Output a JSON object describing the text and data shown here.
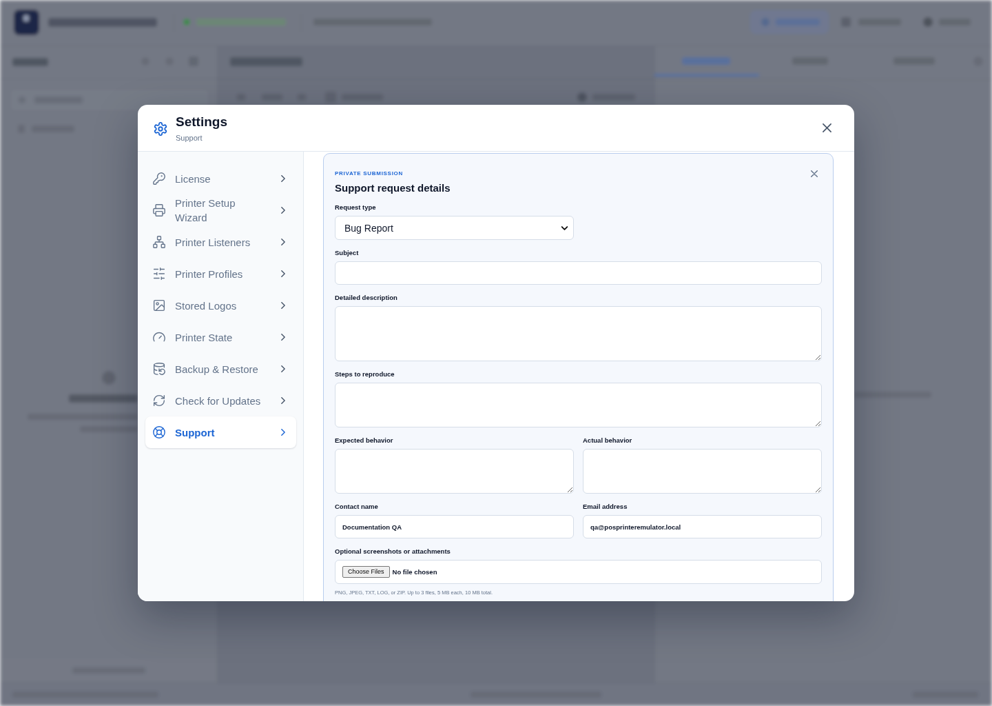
{
  "settings_dialog": {
    "title": "Settings",
    "subtitle": "Support",
    "nav": [
      {
        "label": "License",
        "selected": false
      },
      {
        "label": "Printer Setup Wizard",
        "selected": false
      },
      {
        "label": "Printer Listeners",
        "selected": false
      },
      {
        "label": "Printer Profiles",
        "selected": false
      },
      {
        "label": "Stored Logos",
        "selected": false
      },
      {
        "label": "Printer State",
        "selected": false
      },
      {
        "label": "Backup & Restore",
        "selected": false
      },
      {
        "label": "Check for Updates",
        "selected": false
      },
      {
        "label": "Support",
        "selected": true
      }
    ],
    "support_request": {
      "eyebrow": "PRIVATE SUBMISSION",
      "title": "Support request details",
      "rows": [
        {
          "fields": [
            {
              "kind": "select",
              "label": "Request type",
              "value": "Bug Report"
            }
          ]
        },
        {
          "fields": [
            {
              "kind": "text",
              "label": "Subject"
            }
          ]
        },
        {
          "fields": [
            {
              "kind": "textarea",
              "label": "Detailed description"
            }
          ]
        },
        {
          "fields": [
            {
              "kind": "textarea",
              "label": "Steps to reproduce"
            }
          ]
        },
        {
          "fields": [
            {
              "kind": "textarea",
              "label": "Expected behavior"
            },
            {
              "kind": "textarea",
              "label": "Actual behavior"
            }
          ]
        },
        {
          "fields": [
            {
              "kind": "text",
              "label": "Contact name",
              "value": "Documentation QA"
            },
            {
              "kind": "text",
              "label": "Email address",
              "value": "qa@posprinteremulator.local"
            }
          ]
        },
        {
          "fields": [
            {
              "kind": "file",
              "label": "Optional screenshots or attachments",
              "button": "Choose Files",
              "status": "No file chosen",
              "hint": "PNG, JPEG, TXT, LOG, or ZIP. Up to 3 files, 5 MB each, 10 MB total."
            }
          ]
        }
      ]
    }
  }
}
